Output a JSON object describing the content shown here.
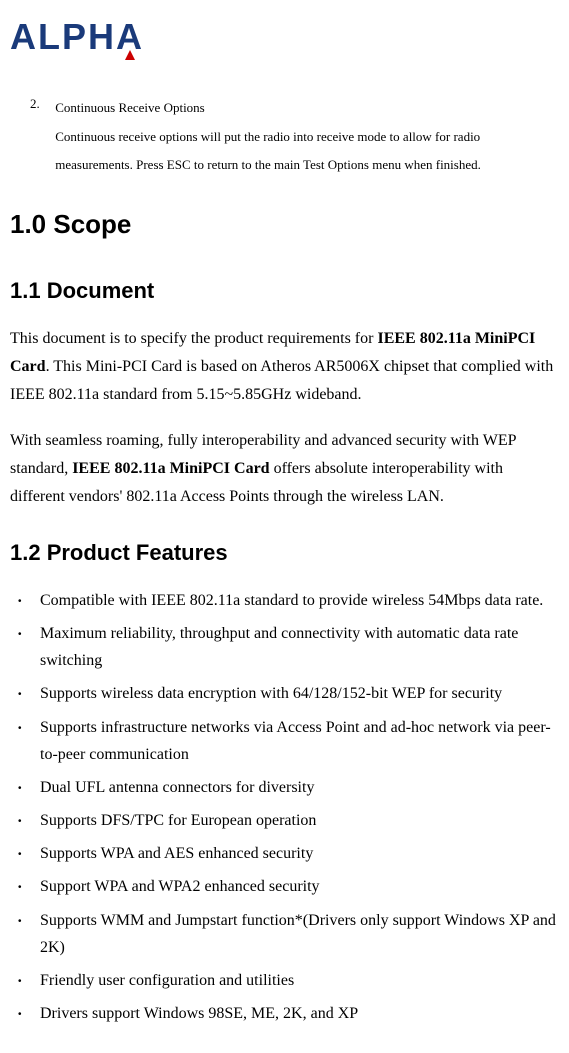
{
  "logo": {
    "text": "ALPHA"
  },
  "numbered": {
    "number": "2.",
    "title": "Continuous Receive Options",
    "body": "Continuous receive options will put the radio into receive mode to allow for radio measurements. Press ESC to return to the main Test Options menu when finished."
  },
  "h1_scope": "1.0 Scope",
  "h2_document": "1.1 Document",
  "doc_para1_pre": "This document is to specify the product requirements for ",
  "doc_para1_bold": "IEEE 802.11a MiniPCI Card",
  "doc_para1_post": ". This Mini-PCI Card is based on Atheros AR5006X chipset that complied with IEEE 802.11a standard from 5.15~5.85GHz wideband.",
  "doc_para2_pre": "With seamless roaming, fully interoperability and advanced security with WEP standard, ",
  "doc_para2_bold": "IEEE 802.11a MiniPCI Card",
  "doc_para2_post": " offers absolute interoperability with different vendors' 802.11a Access Points through the wireless LAN.",
  "h2_features": "1.2 Product Features",
  "features": [
    "Compatible with IEEE 802.11a standard to provide wireless 54Mbps data rate.",
    "Maximum reliability, throughput and connectivity with automatic data rate switching",
    "Supports wireless data encryption with 64/128/152-bit WEP for security",
    "Supports infrastructure networks via Access Point and ad-hoc network via peer-to-peer communication",
    "Dual UFL antenna connectors for diversity",
    "Supports DFS/TPC for European operation",
    "Supports WPA and AES enhanced security",
    "Support WPA and WPA2 enhanced security",
    "Supports WMM and Jumpstart    function*(Drivers only support Windows XP and 2K)",
    "Friendly user configuration and utilities",
    "Drivers support Windows 98SE, ME, 2K, and XP"
  ]
}
